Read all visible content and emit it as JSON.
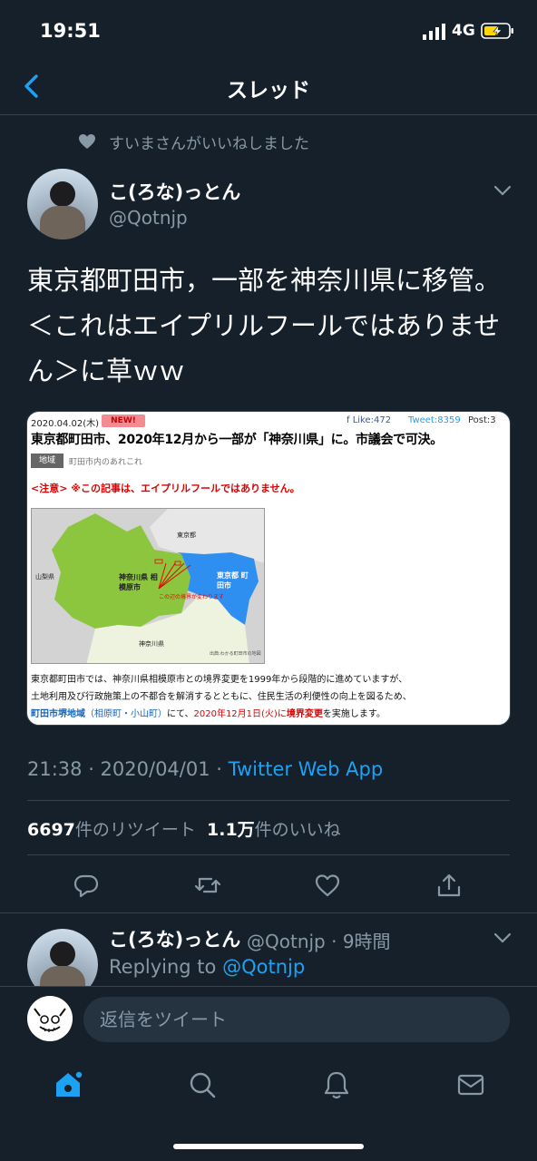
{
  "status_bar": {
    "time": "19:51",
    "network": "4G"
  },
  "nav": {
    "title": "スレッド"
  },
  "social_context": {
    "text": "すいまさんがいいねしました"
  },
  "tweet": {
    "author_name": "こ(ろな)っとん",
    "author_handle": "@Qotnjp",
    "text": "東京都町田市，一部を神奈川県に移管。＜これはエイプリルフールではありません＞に草ｗｗ",
    "timestamp": "21:38 · 2020/04/01 · ",
    "source": "Twitter Web App",
    "retweets_count": "6697",
    "retweets_label": "件のリツイート",
    "likes_count": "1.1万",
    "likes_label": "件のいいね"
  },
  "media": {
    "date": "2020.04.02(木)",
    "new_badge": "NEW!",
    "like": "f Like:472",
    "tweet": "Tweet:8359",
    "post": "Post:3",
    "headline": "東京都町田市、2020年12月から一部が「神奈川県」に。市議会で可決。",
    "tag": "地域",
    "tag_text": "町田市内のあれこれ",
    "note": "<注意> ※この記事は、エイプリルフールではありません。",
    "map_labels": {
      "tokyo": "東京都",
      "yamanashi": "山梨県",
      "kanagawa_sagamihara": "神奈川県 相模原市",
      "tokyo_machida": "東京都 町田市",
      "kanagawa": "神奈川県",
      "border": "この辺の境界が変わります",
      "credit": "出典:わかる町田市の地図"
    },
    "body_line1": "東京都町田市では、神奈川県相模原市との境界変更を1999年から段階的に進めていますが、",
    "body_line2": "土地利用及び行政施策上の不都合を解消するとともに、住民生活の利便性の向上を図るため、",
    "body_line3_a": "町田市堺地域",
    "body_line3_b": "（相原町・小山町）",
    "body_line3_c": "にて、",
    "body_line3_d": "2020年12月1日(火)に",
    "body_line3_e": "境界変更",
    "body_line3_f": "を実施します。"
  },
  "reply": {
    "author_name": "こ(ろな)っとん",
    "meta": "@Qotnjp · 9時間",
    "replying_prefix": "Replying to ",
    "replying_handle": "@Qotnjp"
  },
  "composer": {
    "placeholder": "返信をツイート"
  },
  "icons": {
    "back": "chevron-left-icon",
    "heart": "heart-icon",
    "caret": "chevron-down-icon",
    "reply": "comment-icon",
    "retweet": "retweet-icon",
    "like": "heart-outline-icon",
    "share": "share-icon",
    "home": "home-icon",
    "search": "search-icon",
    "notifications": "bell-icon",
    "messages": "mail-icon"
  },
  "colors": {
    "background": "#15202b",
    "accent": "#1da1f2",
    "secondary_text": "#8899a6",
    "divider": "#38444d"
  }
}
